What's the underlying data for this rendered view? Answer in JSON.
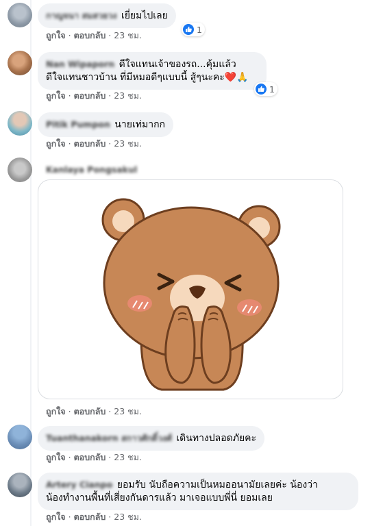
{
  "comments": [
    {
      "author": "กาญจนา สมสวยวง",
      "text": "เยี่ยมไปเลย",
      "actions": {
        "like": "ถูกใจ",
        "reply": "ตอบกลับ",
        "time": "23 ชม."
      },
      "reaction_count": "1"
    },
    {
      "author": "Nan Wipaporn",
      "text_line1": "ดีใจแทนเจ้าของรถ...คุ้มแล้ว",
      "text_line2": "ดีใจแทนชาวบ้าน ที่มีหมอดีๆแบบนี้ สู้ๆนะคะ❤️🙏",
      "actions": {
        "like": "ถูกใจ",
        "reply": "ตอบกลับ",
        "time": "23 ชม."
      },
      "reaction_count": "1"
    },
    {
      "author": "Pitik Pumpon",
      "text": "นายเท่มากก",
      "actions": {
        "like": "ถูกใจ",
        "reply": "ตอบกลับ",
        "time": "23 ชม."
      }
    },
    {
      "author": "Kanlaya Pongsakul",
      "sticker": "bear-covering-mouth-sticker",
      "actions": {
        "like": "ถูกใจ",
        "reply": "ตอบกลับ",
        "time": "23 ชม."
      }
    },
    {
      "author": "Tuanthanakorn สกาวศักดิ์วงศ์",
      "text": "เดินทางปลอดภัยคะ",
      "actions": {
        "like": "ถูกใจ",
        "reply": "ตอบกลับ",
        "time": "23 ชม."
      }
    },
    {
      "author": "Artery Cianpo",
      "text_line1": "ยอมรับ นับถือความเป็นหมออนามัยเลยค่ะ น้องว่า",
      "text_line2": "น้องทำงานพื้นที่เสี่ยงกันดารแล้ว มาเจอแบบพี่นี่ ยอมเลย",
      "actions": {
        "like": "ถูกใจ",
        "reply": "ตอบกลับ",
        "time": "23 ชม."
      }
    }
  ],
  "colors": {
    "bubble": "#f0f2f5",
    "like_blue": "#1877f2",
    "meta_gray": "#65676b"
  },
  "icons": {
    "like": "thumbs-up-icon",
    "pray": "folded-hands-icon",
    "heart": "red-heart-emoji"
  }
}
